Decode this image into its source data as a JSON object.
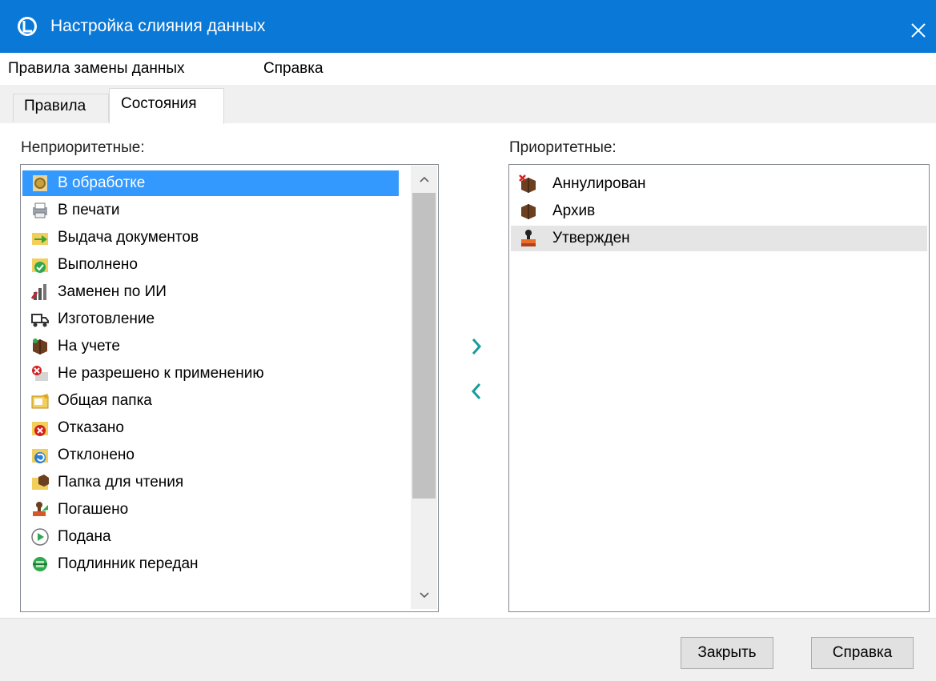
{
  "window": {
    "title": "Настройка слияния данных"
  },
  "menu": {
    "items": [
      "Правила замены данных",
      "Справка"
    ]
  },
  "tabs": [
    {
      "label": "Правила",
      "active": false
    },
    {
      "label": "Состояния",
      "active": true
    }
  ],
  "left_panel": {
    "label": "Неприоритетные:",
    "items": [
      {
        "label": "В обработке",
        "icon": "gear-processing-icon",
        "selected": true
      },
      {
        "label": "В печати",
        "icon": "printer-icon"
      },
      {
        "label": "Выдача документов",
        "icon": "folder-arrow-icon"
      },
      {
        "label": "Выполнено",
        "icon": "folder-check-icon"
      },
      {
        "label": "Заменен по ИИ",
        "icon": "chart-replace-icon"
      },
      {
        "label": "Изготовление",
        "icon": "truck-icon"
      },
      {
        "label": "На учете",
        "icon": "box-accounted-icon"
      },
      {
        "label": "Не разрешено к применению",
        "icon": "forbidden-icon"
      },
      {
        "label": "Общая папка",
        "icon": "shared-folder-icon"
      },
      {
        "label": "Отказано",
        "icon": "folder-refused-icon"
      },
      {
        "label": "Отклонено",
        "icon": "folder-rejected-icon"
      },
      {
        "label": "Папка для чтения",
        "icon": "folder-read-icon"
      },
      {
        "label": "Погашено",
        "icon": "stamp-repaid-icon"
      },
      {
        "label": "Подана",
        "icon": "play-circle-icon"
      },
      {
        "label": "Подлинник передан",
        "icon": "original-transferred-icon"
      }
    ]
  },
  "right_panel": {
    "label": "Приоритетные:",
    "items": [
      {
        "label": "Аннулирован",
        "icon": "box-cancelled-icon"
      },
      {
        "label": "Архив",
        "icon": "box-archive-icon"
      },
      {
        "label": "Утвержден",
        "icon": "stamp-approved-icon",
        "highlighted": true
      }
    ]
  },
  "buttons": {
    "close": "Закрыть",
    "help": "Справка"
  },
  "colors": {
    "titlebar": "#0a78d7",
    "selection": "#3399ff",
    "move_arrows": "#1a9a9a"
  }
}
